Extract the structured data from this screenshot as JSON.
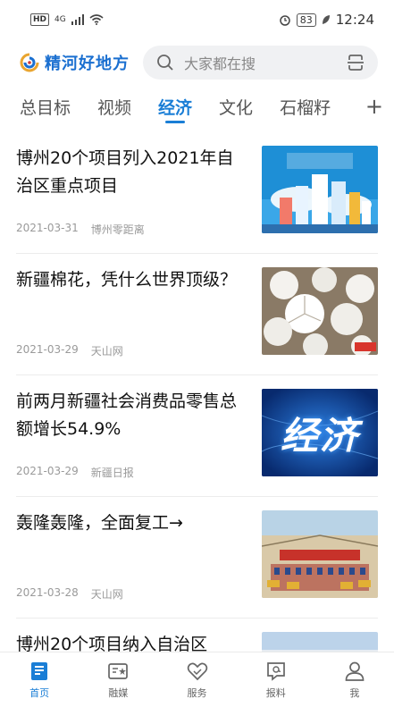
{
  "status_bar": {
    "hd": "HD",
    "network": "4G",
    "battery": "83",
    "time": "12:24"
  },
  "header": {
    "app_name": "精河好地方",
    "search_placeholder": "大家都在搜"
  },
  "tabs": [
    {
      "label": "总目标",
      "active": false
    },
    {
      "label": "视频",
      "active": false
    },
    {
      "label": "经济",
      "active": true
    },
    {
      "label": "文化",
      "active": false
    },
    {
      "label": "石榴籽",
      "active": false
    }
  ],
  "tab_add": "+",
  "news": [
    {
      "title": "博州20个项目列入2021年自治区重点项目",
      "date": "2021-03-31",
      "source": "博州零距离",
      "thumb": "city-illustration"
    },
    {
      "title": "新疆棉花，凭什么世界顶级？",
      "date": "2021-03-29",
      "source": "天山网",
      "thumb": "cotton"
    },
    {
      "title": "前两月新疆社会消费品零售总额增长54.9%",
      "date": "2021-03-29",
      "source": "新疆日报",
      "thumb": "economy-banner",
      "thumb_text": "经济"
    },
    {
      "title": "轰隆轰隆，全面复工→",
      "date": "2021-03-28",
      "source": "天山网",
      "thumb": "construction-site"
    },
    {
      "title": "博州20个项目纳入自治区",
      "date": "",
      "source": "",
      "thumb": "landscape"
    }
  ],
  "bottom_nav": [
    {
      "label": "首页",
      "icon": "home-icon",
      "active": true
    },
    {
      "label": "融媒",
      "icon": "media-icon",
      "active": false
    },
    {
      "label": "服务",
      "icon": "service-icon",
      "active": false
    },
    {
      "label": "报料",
      "icon": "report-icon",
      "active": false
    },
    {
      "label": "我",
      "icon": "profile-icon",
      "active": false
    }
  ],
  "colors": {
    "accent": "#1a7ed6",
    "brand": "#1a6fd0"
  }
}
